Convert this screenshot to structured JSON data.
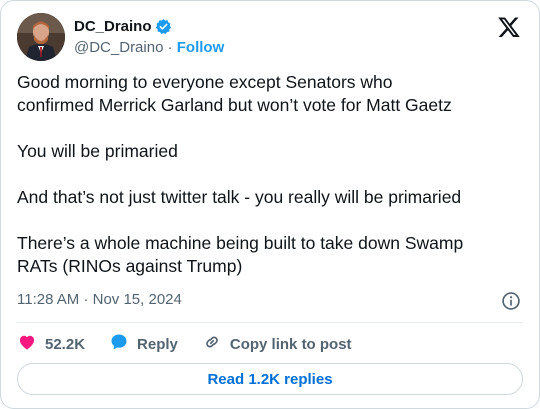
{
  "author": {
    "display_name": "DC_Draino",
    "handle": "@DC_Draino",
    "separator": "·",
    "follow_label": "Follow"
  },
  "tweet": {
    "text": "Good morning to everyone except Senators who\nconfirmed Merrick Garland but won’t vote for Matt Gaetz\n\nYou will be primaried\n\nAnd that’s not just twitter talk - you really will be primaried\n\nThere’s a whole machine being built to take down Swamp\nRATs (RINOs against Trump)",
    "time": "11:28 AM",
    "date": "Nov 15, 2024",
    "meta_separator": "·"
  },
  "actions": {
    "like_count": "52.2K",
    "reply_label": "Reply",
    "copy_label": "Copy link to post"
  },
  "replies_button": "Read 1.2K replies",
  "colors": {
    "accent": "#1d9bf0",
    "like": "#f91880",
    "link": "#006fd6",
    "muted": "#536471"
  },
  "icons": [
    "verified-badge-icon",
    "x-logo-icon",
    "info-icon",
    "heart-icon",
    "reply-bubble-icon",
    "link-icon"
  ]
}
